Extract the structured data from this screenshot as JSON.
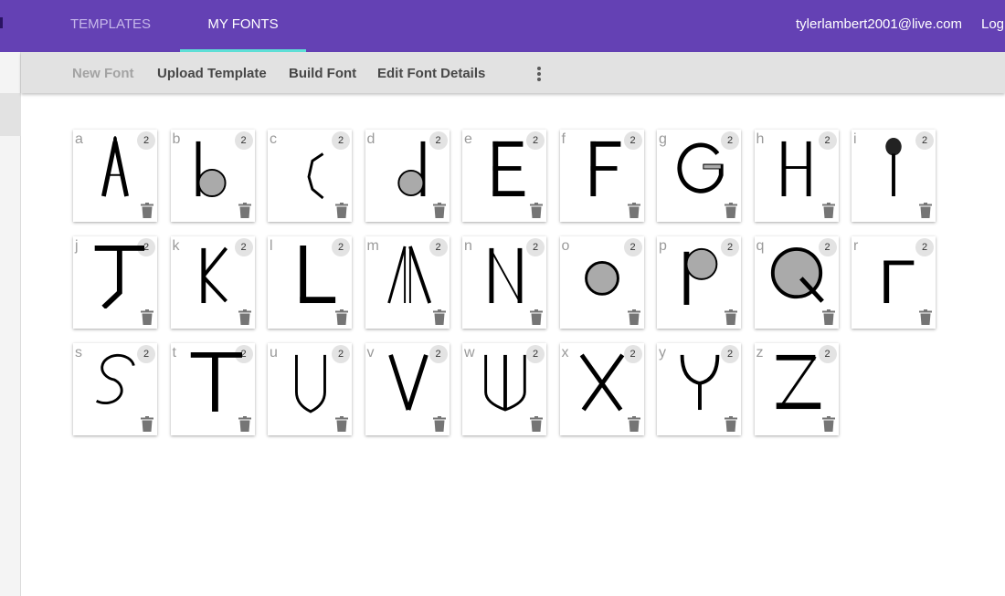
{
  "appbar": {
    "tabs": [
      {
        "label": "TEMPLATES",
        "active": false
      },
      {
        "label": "MY FONTS",
        "active": true
      }
    ],
    "user_email": "tylerlambert2001@live.com",
    "logout_label": "Log",
    "accent_color": "#6441b4",
    "indicator_color": "#5fe1d8"
  },
  "toolbar": {
    "new_font": "New Font",
    "upload_template": "Upload Template",
    "build_font": "Build Font",
    "edit_font_details": "Edit Font Details",
    "more_icon": "more-vert-icon"
  },
  "glyphs": [
    {
      "label": "a",
      "count": "2"
    },
    {
      "label": "b",
      "count": "2"
    },
    {
      "label": "c",
      "count": "2"
    },
    {
      "label": "d",
      "count": "2"
    },
    {
      "label": "e",
      "count": "2"
    },
    {
      "label": "f",
      "count": "2"
    },
    {
      "label": "g",
      "count": "2"
    },
    {
      "label": "h",
      "count": "2"
    },
    {
      "label": "i",
      "count": "2"
    },
    {
      "label": "j",
      "count": "2"
    },
    {
      "label": "k",
      "count": "2"
    },
    {
      "label": "l",
      "count": "2"
    },
    {
      "label": "m",
      "count": "2"
    },
    {
      "label": "n",
      "count": "2"
    },
    {
      "label": "o",
      "count": "2"
    },
    {
      "label": "p",
      "count": "2"
    },
    {
      "label": "q",
      "count": "2"
    },
    {
      "label": "r",
      "count": "2"
    },
    {
      "label": "s",
      "count": "2"
    },
    {
      "label": "t",
      "count": "2"
    },
    {
      "label": "u",
      "count": "2"
    },
    {
      "label": "v",
      "count": "2"
    },
    {
      "label": "w",
      "count": "2"
    },
    {
      "label": "x",
      "count": "2"
    },
    {
      "label": "y",
      "count": "2"
    },
    {
      "label": "z",
      "count": "2"
    }
  ]
}
